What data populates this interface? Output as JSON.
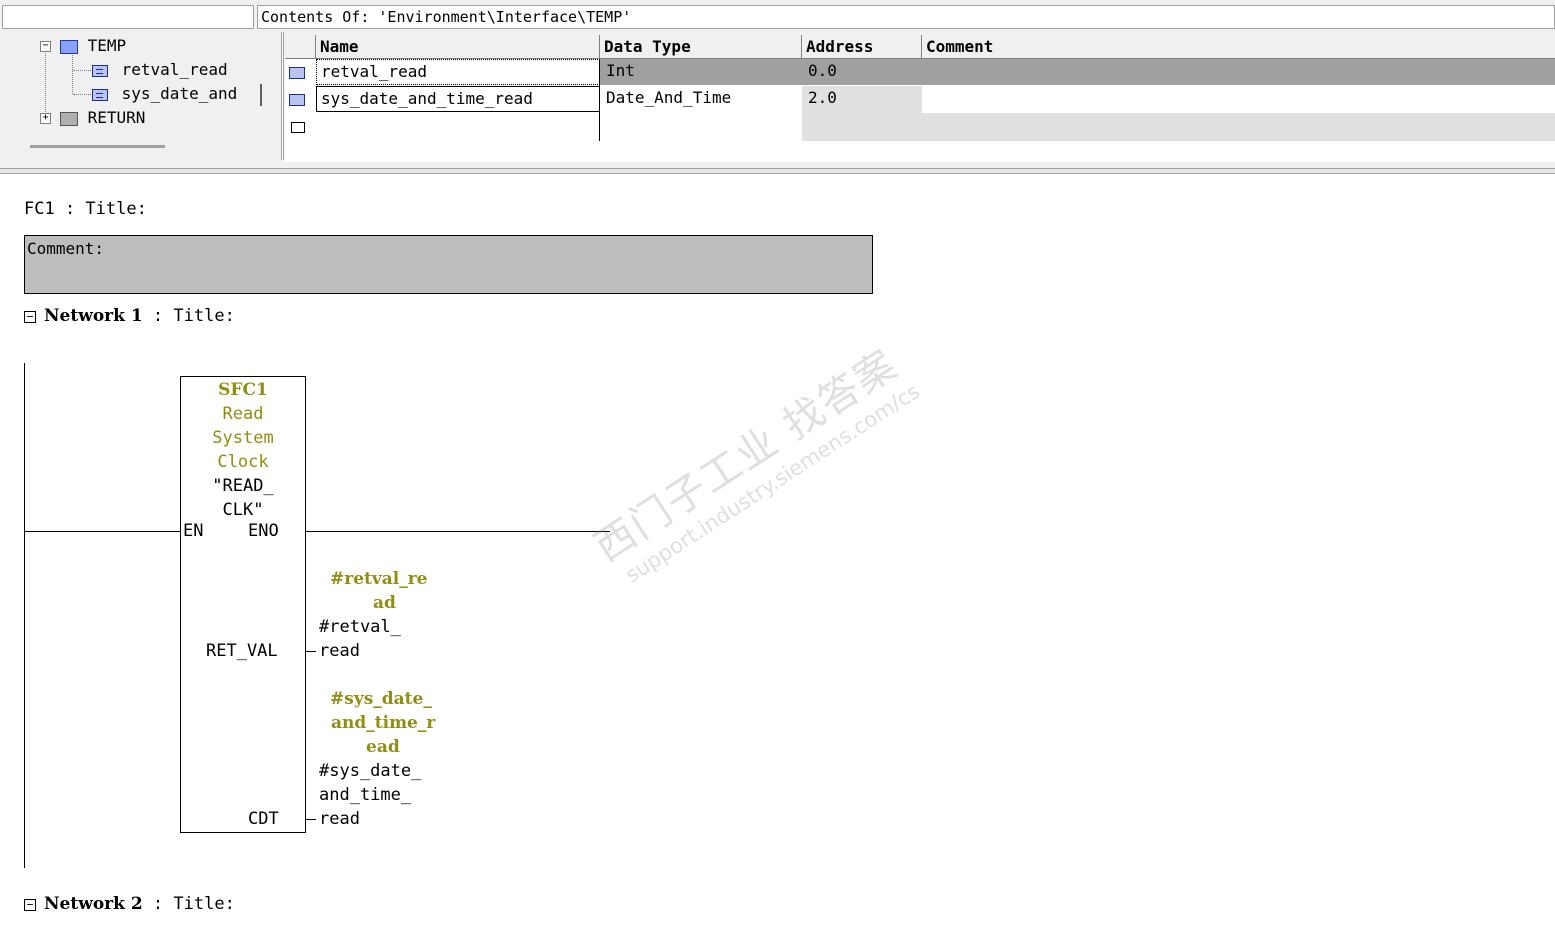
{
  "interface": {
    "path": "Contents Of: 'Environment\\Interface\\TEMP'",
    "tree": {
      "temp_label": "TEMP",
      "items": [
        "retval_read",
        "sys_date_and"
      ],
      "return_label": "RETURN"
    },
    "columns": [
      "Name",
      "Data Type",
      "Address",
      "Comment"
    ],
    "rows": [
      {
        "name": "retval_read",
        "type": "Int",
        "address": "0.0",
        "comment": ""
      },
      {
        "name": "sys_date_and_time_read",
        "type": "Date_And_Time",
        "address": "2.0",
        "comment": ""
      }
    ]
  },
  "block": {
    "title": "FC1 : Title:",
    "comment_label": "Comment:"
  },
  "network1": {
    "label": "Network 1",
    "title_suffix": ": Title:",
    "fb": {
      "name": "SFC1",
      "desc_lines": [
        "Read",
        "System",
        "Clock"
      ],
      "symbol_lines": [
        "\"READ_",
        "CLK\""
      ],
      "pin_en": "EN",
      "pin_eno": "ENO",
      "pin_retval": "RET_VAL",
      "pin_cdt": "CDT"
    },
    "op_retval": {
      "symbol_lines": [
        "#retval_re",
        "ad"
      ],
      "addr_lines": [
        "#retval_",
        "read"
      ]
    },
    "op_cdt": {
      "symbol_lines": [
        "#sys_date_",
        "and_time_r",
        "ead"
      ],
      "addr_lines": [
        "#sys_date_",
        "and_time_",
        "read"
      ]
    }
  },
  "network2": {
    "label": "Network 2",
    "title_suffix": ": Title:"
  },
  "watermark": {
    "line1": "西门子工业  找答案",
    "line2": "support.industry.siemens.com/cs"
  },
  "colors": {
    "highlight_row": "#a0a0a0",
    "operand_symbol": "#8f8f12",
    "comment_bg": "#bdbdbd"
  }
}
